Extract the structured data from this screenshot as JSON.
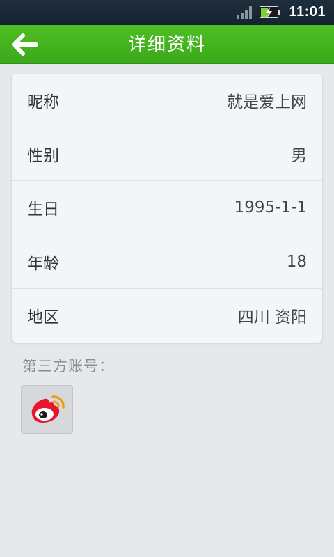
{
  "status_bar": {
    "time": "11:01",
    "signal_icon": "signal-icon",
    "battery_icon": "battery-charging-icon"
  },
  "header": {
    "title": "详细资料",
    "back_icon": "arrow-left-icon",
    "background_color": "#3aa81a"
  },
  "profile": {
    "rows": [
      {
        "label": "昵称",
        "value": "就是爱上网"
      },
      {
        "label": "性别",
        "value": "男"
      },
      {
        "label": "生日",
        "value": "1995-1-1"
      },
      {
        "label": "年龄",
        "value": "18"
      },
      {
        "label": "地区",
        "value": "四川 资阳"
      }
    ]
  },
  "third_party": {
    "label": "第三方账号：",
    "accounts": [
      {
        "icon": "weibo-icon"
      }
    ]
  }
}
